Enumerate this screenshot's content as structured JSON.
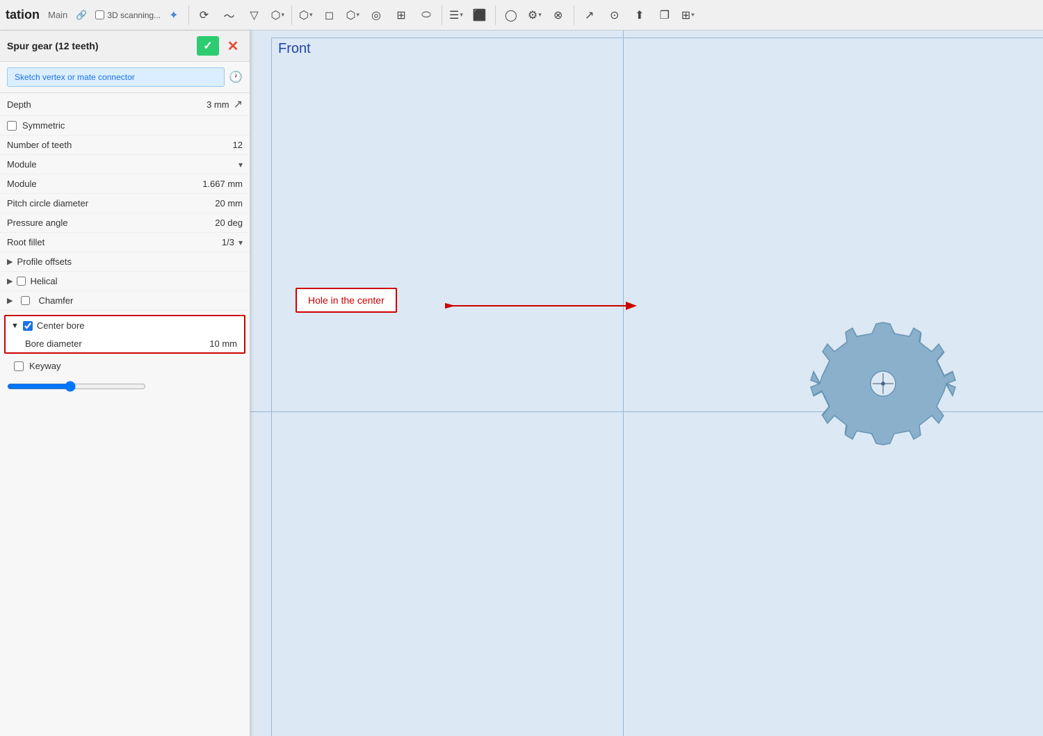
{
  "app": {
    "title": "tation",
    "subtitle": "Main",
    "scanning_label": "3D scanning..."
  },
  "toolbar": {
    "buttons": [
      "rotate",
      "curve",
      "cone",
      "extrude-arrow",
      "copy",
      "copy-arrow",
      "flat",
      "group-arrow",
      "boolean",
      "grid",
      "cylinder",
      "combined",
      "display-arrow",
      "stack",
      "circle",
      "box-select",
      "gear-arrow",
      "close",
      "cursor",
      "x-circle",
      "export",
      "copy2",
      "layout-arrow"
    ]
  },
  "panel": {
    "title": "Spur gear (12 teeth)",
    "confirm_label": "✓",
    "cancel_label": "✕",
    "sketch_placeholder": "Sketch vertex or mate connector",
    "depth_label": "Depth",
    "depth_value": "3 mm",
    "symmetric_label": "Symmetric",
    "teeth_label": "Number of teeth",
    "teeth_value": "12",
    "module_dropdown_label": "Module",
    "module_label": "Module",
    "module_value": "1.667 mm",
    "pitch_label": "Pitch circle diameter",
    "pitch_value": "20 mm",
    "pressure_label": "Pressure angle",
    "pressure_value": "20 deg",
    "root_label": "Root fillet",
    "root_value": "1/3",
    "profile_offsets_label": "Profile offsets",
    "helical_label": "Helical",
    "chamfer_label": "Chamfer",
    "center_bore_label": "Center bore",
    "bore_diameter_label": "Bore diameter",
    "bore_diameter_value": "10 mm",
    "keyway_label": "Keyway"
  },
  "viewport": {
    "front_label": "Front",
    "annotation_label": "Hole in the center"
  },
  "colors": {
    "accent_blue": "#1a73e8",
    "confirm_green": "#2ecc71",
    "cancel_red": "#e74c3c",
    "annotation_red": "#cc0000",
    "sketch_bg": "#dbeeff",
    "sketch_border": "#99c9f0"
  }
}
